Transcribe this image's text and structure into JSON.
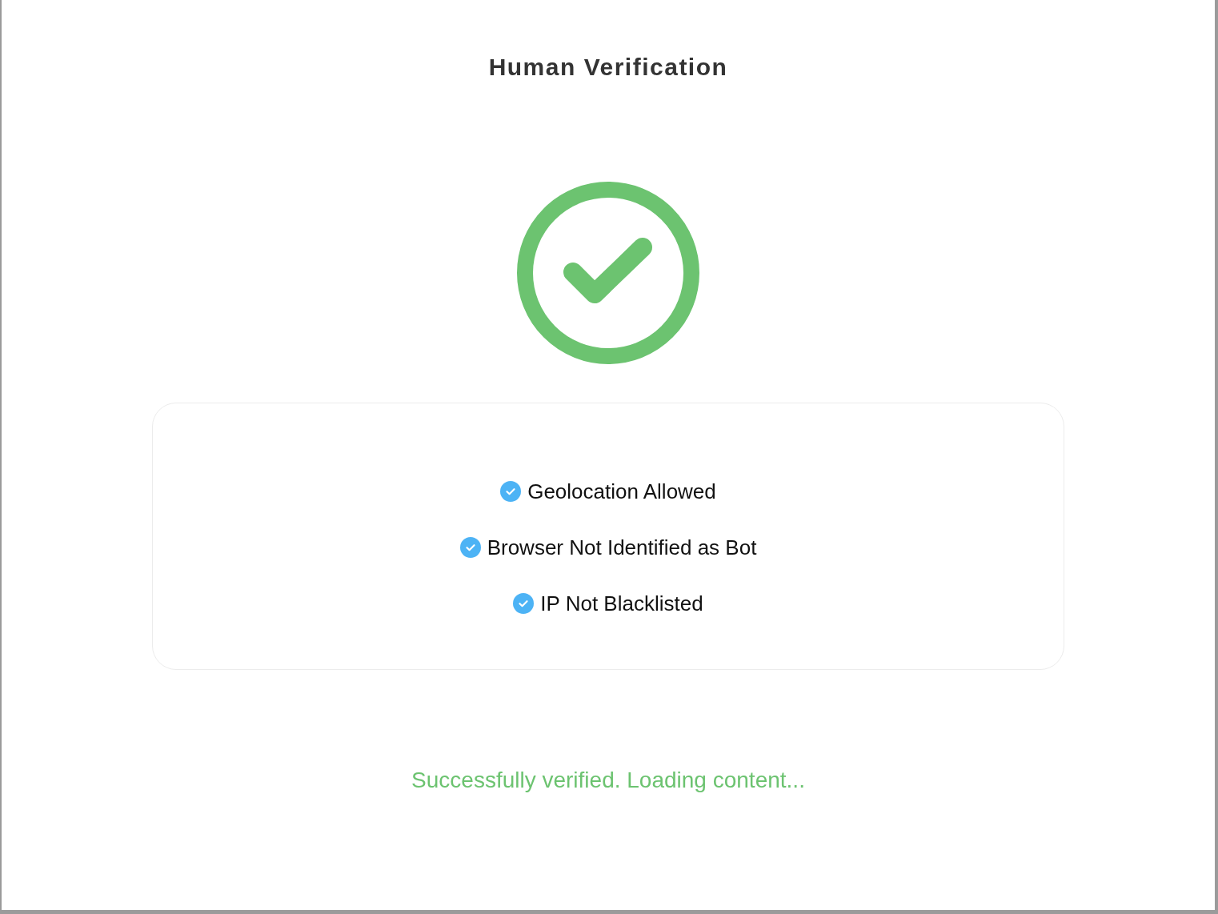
{
  "title": "Human Verification",
  "result": {
    "kind": "success",
    "message": "Successfully verified. Loading content..."
  },
  "checks": [
    {
      "label": "Geolocation Allowed",
      "passed": true
    },
    {
      "label": "Browser Not Identified as Bot",
      "passed": true
    },
    {
      "label": "IP Not Blacklisted",
      "passed": true
    }
  ]
}
